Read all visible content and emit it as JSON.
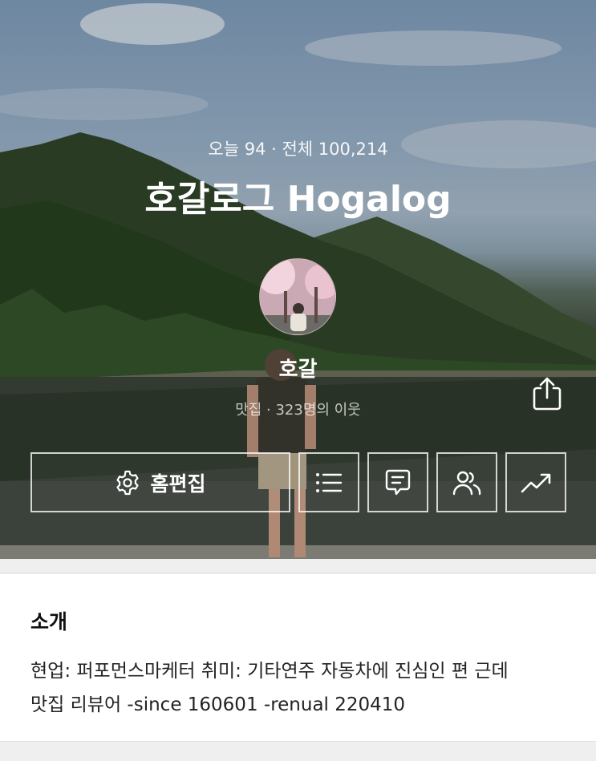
{
  "header": {
    "stats": "오늘 94 · 전체 100,214",
    "title": "호갈로그 Hogalog"
  },
  "profile": {
    "nickname": "호갈",
    "meta": "맛집 · 323명의 이웃",
    "avatar_icon": "profile-photo"
  },
  "actions": {
    "edit_label": "홈편집",
    "edit_icon": "gear-icon",
    "list_icon": "list-icon",
    "comment_icon": "comment-icon",
    "neighbor_icon": "people-icon",
    "stats_icon": "trend-icon",
    "share_icon": "share-icon"
  },
  "intro": {
    "heading": "소개",
    "body": "현업: 퍼포먼스마케터  취미: 기타연주  자동차에 진심인 편 근데\n맛집 리뷰어  -since 160601  -renual 220410"
  },
  "colors": {
    "accent_text": "#ffffff",
    "panel_bg": "#ffffff",
    "page_bg": "#efefef"
  }
}
